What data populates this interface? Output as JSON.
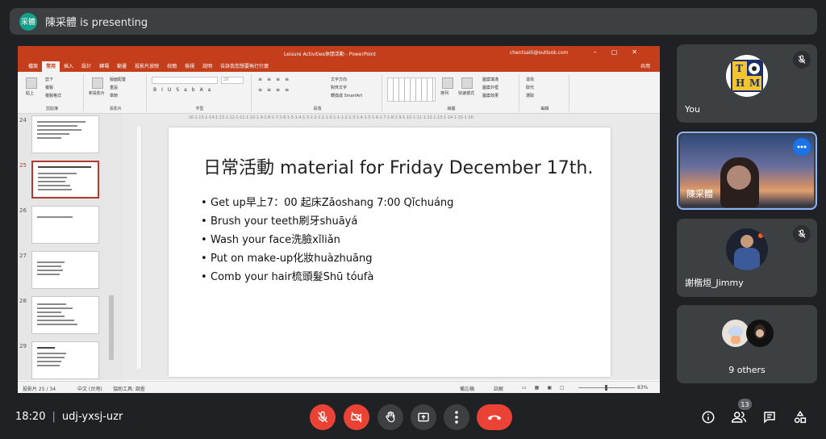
{
  "presenter": {
    "avatar_text": "采體",
    "text": "陳采體 is presenting"
  },
  "powerpoint": {
    "window_title": "Leisure Activities休閒活動 - PowerPoint",
    "account": "chentsaiti@outlook.com",
    "tabs": [
      "檔案",
      "常用",
      "插入",
      "設計",
      "轉場",
      "動畫",
      "投影片放映",
      "校閱",
      "檢視",
      "說明",
      "告訴我您想要執行什麼"
    ],
    "share_label": "共用",
    "ribbon_groups": {
      "clipboard": "剪貼簿",
      "slides": "投影片",
      "font": "字型",
      "paragraph": "段落",
      "drawing": "繪圖",
      "editing": "編輯"
    },
    "ribbon_items": {
      "paste": "貼上",
      "cut": "剪下",
      "copy": "複製",
      "format_painter": "複製格式",
      "new_slide": "新投影片",
      "layout": "版面配置",
      "reset": "重設",
      "section": "章節",
      "text_direction": "文字方向",
      "align_text": "對齊文字",
      "smartart": "轉換成 SmartArt",
      "arrange": "排列",
      "quick_styles": "快速樣式",
      "shape_fill": "圖案填滿",
      "shape_outline": "圖案外框",
      "shape_effects": "圖案效果",
      "find": "尋找",
      "replace": "取代",
      "select": "選取",
      "font_size": "28"
    },
    "ruler_text": "·16·1·15·1·14·1·13·1·12·1·11·1·10·1·9·1·8·1·7·1·6·1·5·1·4·1·3·1·2·1·1·1·0·1·1·1·2·1·3·1·4·1·5·1·6·1·7·1·8·1·9·1·10·1·11·1·12·1·13·1·14·1·15·1·16·",
    "thumbnails": [
      {
        "number": "24"
      },
      {
        "number": "25"
      },
      {
        "number": "26"
      },
      {
        "number": "27"
      },
      {
        "number": "28"
      },
      {
        "number": "29"
      }
    ],
    "slide": {
      "title": "日常活動 material for Friday December 17th.",
      "bullets": [
        "Get up早上7：00 起床Zǎoshang 7:00 Qǐchuáng",
        "Brush your teeth刷牙shuāyá",
        "Wash your face洗臉xǐliǎn",
        "Put on make-up化妝huàzhuāng",
        "Comb your hair梳頭髮Shū tóufà"
      ]
    },
    "status": {
      "slide_counter": "投影片 25 / 34",
      "language": "中文 (台灣)",
      "accessibility": "協助工具: 調查",
      "notes": "備忘稿",
      "comments": "註解",
      "zoom": "83%"
    }
  },
  "participants": [
    {
      "name": "You",
      "avatar_letters": [
        "T",
        "H",
        "M"
      ]
    },
    {
      "name": "陳采體"
    },
    {
      "name": "謝楷烜_Jimmy"
    },
    {
      "name": "9 others"
    }
  ],
  "meeting": {
    "time": "18:20",
    "code": "udj-yxsj-uzr",
    "people_count": "13"
  },
  "colors": {
    "background": "#202124",
    "tile": "#3c4043",
    "danger": "#ea4335",
    "accent": "#1a73e8",
    "ppt_brand": "#c43e1c"
  },
  "icons": {
    "mic": "mic-off-icon",
    "camera": "camera-off-icon",
    "hand": "raise-hand-icon",
    "present": "present-icon",
    "more": "more-vert-icon",
    "hangup": "hangup-icon",
    "info": "info-icon",
    "people": "people-icon",
    "chat": "chat-icon",
    "activities": "activities-icon"
  }
}
